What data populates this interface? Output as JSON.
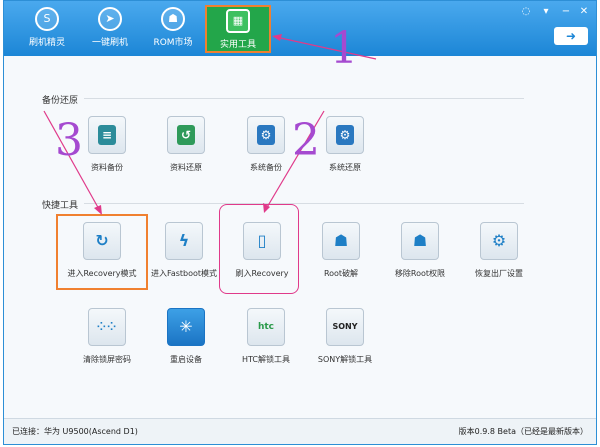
{
  "nav": {
    "items": [
      {
        "label": "刷机精灵",
        "icon": "logo-icon"
      },
      {
        "label": "一键刷机",
        "icon": "cursor-icon"
      },
      {
        "label": "ROM市场",
        "icon": "android-icon"
      },
      {
        "label": "实用工具",
        "icon": "grid-icon",
        "active": true
      }
    ]
  },
  "sections": {
    "backup": {
      "title": "备份还原",
      "tools": [
        {
          "label": "资料备份",
          "icon": "document-icon"
        },
        {
          "label": "资料还原",
          "icon": "restore-icon"
        },
        {
          "label": "系统备份",
          "icon": "system-backup-icon"
        },
        {
          "label": "系统还原",
          "icon": "system-restore-icon"
        }
      ]
    },
    "quick": {
      "title": "快捷工具",
      "row1": [
        {
          "label": "进入Recovery模式",
          "icon": "refresh-icon"
        },
        {
          "label": "进入Fastboot模式",
          "icon": "lightning-icon"
        },
        {
          "label": "刷入Recovery",
          "icon": "device-icon"
        },
        {
          "label": "Root破解",
          "icon": "android-icon"
        },
        {
          "label": "移除Root权限",
          "icon": "android-remove-icon"
        },
        {
          "label": "恢复出厂设置",
          "icon": "gear-icon"
        }
      ],
      "row2": [
        {
          "label": "清除锁屏密码",
          "icon": "pattern-lock-icon"
        },
        {
          "label": "重启设备",
          "icon": "restart-icon"
        },
        {
          "label": "HTC解锁工具",
          "icon": "htc-icon"
        },
        {
          "label": "SONY解锁工具",
          "icon": "sony-icon"
        }
      ]
    }
  },
  "status": {
    "connection": "已连接：华为 U9500(Ascend D1)",
    "version": "版本0.9.8 Beta（已经是最新版本）"
  },
  "annotations": {
    "n1": "1",
    "n2": "2",
    "n3": "3"
  },
  "colors": {
    "accent": "#1c86d6",
    "active_tab": "#23a64a",
    "highlight_orange": "#f08030",
    "highlight_pink": "#e03a8a",
    "annotation_purple": "#a54ad0"
  }
}
